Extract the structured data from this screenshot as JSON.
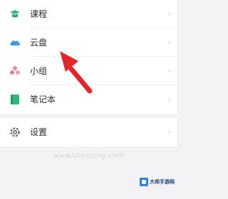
{
  "menu": {
    "items": [
      {
        "label": "课程",
        "icon": "graduation-cap-icon",
        "color": "#2fbf8a"
      },
      {
        "label": "云盘",
        "icon": "cloud-icon",
        "color": "#3d9be0"
      },
      {
        "label": "小组",
        "icon": "group-icon",
        "color": "#e98aa0"
      },
      {
        "label": "笔记本",
        "icon": "notebook-icon",
        "color": "#2fb67d"
      }
    ],
    "settings": {
      "label": "设置",
      "icon": "gear-icon",
      "color": "#666666"
    },
    "chevron": "›"
  },
  "watermark": "www.Uroening.com",
  "logo": {
    "title": "大师手游网",
    "subtitle": ""
  },
  "annotation": {
    "arrow_color": "#e0272c"
  }
}
